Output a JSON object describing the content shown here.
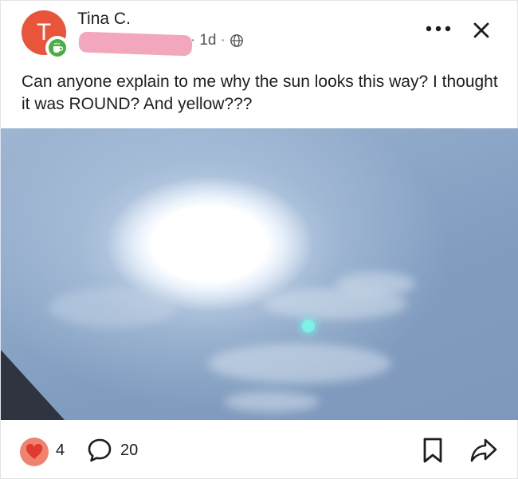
{
  "post": {
    "author": "Tina C.",
    "avatar_initial": "T",
    "age": "1d",
    "separator": "·",
    "text": "Can anyone explain to me why the sun looks this way? I thought it was ROUND? And yellow???"
  },
  "reactions": {
    "count": "4",
    "comments": "20"
  },
  "colors": {
    "avatar": "#e8553a",
    "badge": "#4cad46",
    "redaction": "#f3a7bd",
    "reaction_heart": "#f0836f"
  },
  "icons": {
    "badge": "coffee-cup-icon",
    "privacy": "globe-icon",
    "menu": "more-dots-icon",
    "close": "close-icon",
    "reaction": "heart-icon",
    "comment": "comment-bubble-icon",
    "save": "bookmark-icon",
    "share": "share-arrow-icon"
  }
}
